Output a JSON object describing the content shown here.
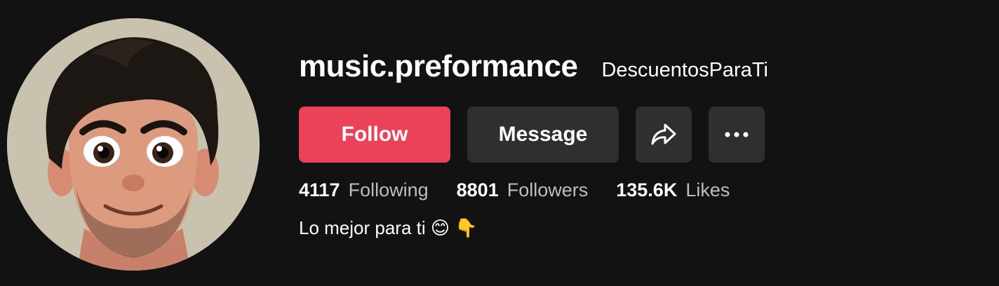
{
  "profile": {
    "username": "music.preformance",
    "nickname": "DescuentosParaTi",
    "avatar_alt": "cartoon-avatar",
    "bio": "Lo mejor para ti 😊 👇"
  },
  "actions": {
    "follow_label": "Follow",
    "message_label": "Message",
    "share_icon": "share-icon",
    "more_icon": "more-icon"
  },
  "stats": [
    {
      "value": "4117",
      "label": "Following"
    },
    {
      "value": "8801",
      "label": "Followers"
    },
    {
      "value": "135.6K",
      "label": "Likes"
    }
  ],
  "colors": {
    "background": "#121212",
    "follow_button": "#ea4359",
    "secondary_button": "#2f2f2f",
    "muted_text": "#bdbdbd"
  }
}
